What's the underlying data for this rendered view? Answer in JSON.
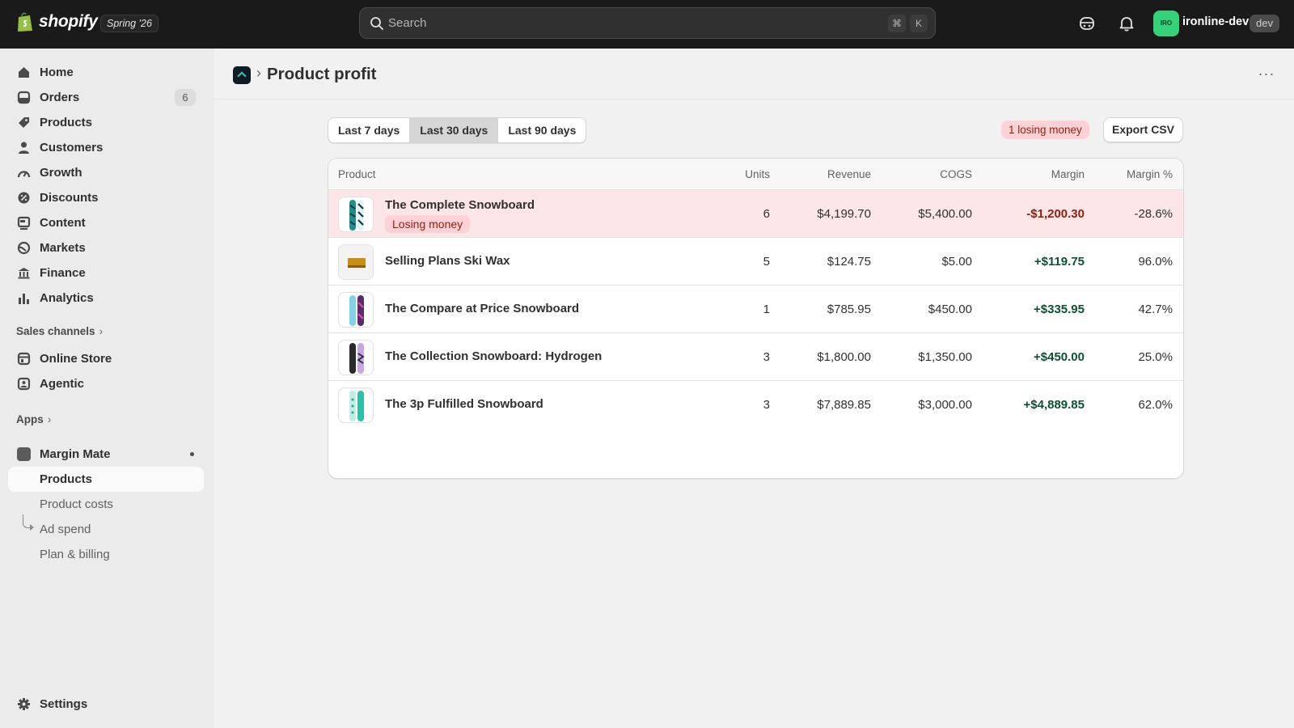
{
  "topbar": {
    "brand": "shopify",
    "edition": "Spring '26",
    "search_placeholder": "Search",
    "shortcut_cmd": "⌘",
    "shortcut_key": "K",
    "avatar_initials": "IRO",
    "store_name": "ironline-dev",
    "store_badge": "dev"
  },
  "sidebar": {
    "items": [
      {
        "label": "Home",
        "icon": "home-icon"
      },
      {
        "label": "Orders",
        "icon": "orders-icon",
        "count": "6"
      },
      {
        "label": "Products",
        "icon": "tag-icon"
      },
      {
        "label": "Customers",
        "icon": "person-icon"
      },
      {
        "label": "Growth",
        "icon": "growth-icon"
      },
      {
        "label": "Discounts",
        "icon": "discount-icon"
      },
      {
        "label": "Content",
        "icon": "content-icon"
      },
      {
        "label": "Markets",
        "icon": "globe-icon"
      },
      {
        "label": "Finance",
        "icon": "bank-icon"
      },
      {
        "label": "Analytics",
        "icon": "chart-icon"
      }
    ],
    "sales_channels_label": "Sales channels",
    "channels": [
      {
        "label": "Online Store",
        "icon": "store-icon"
      },
      {
        "label": "Agentic",
        "icon": "agent-icon"
      }
    ],
    "apps_label": "Apps",
    "app": {
      "name": "Margin Mate",
      "subitems": [
        "Products",
        "Product costs",
        "Ad spend",
        "Plan & billing"
      ]
    },
    "settings_label": "Settings"
  },
  "page": {
    "title": "Product profit",
    "more": "···",
    "ranges": [
      "Last 7 days",
      "Last 30 days",
      "Last 90 days"
    ],
    "selected_range": "Last 30 days",
    "losing_summary": "1 losing money",
    "export_label": "Export CSV"
  },
  "table": {
    "headers": {
      "product": "Product",
      "units": "Units",
      "revenue": "Revenue",
      "cogs": "COGS",
      "margin": "Margin",
      "margin_pct": "Margin %"
    },
    "rows": [
      {
        "name": "The Complete Snowboard",
        "badge": "Losing money",
        "units": "6",
        "revenue": "$4,199.70",
        "cogs": "$5,400.00",
        "margin": "-$1,200.30",
        "margin_pct": "-28.6%"
      },
      {
        "name": "Selling Plans Ski Wax",
        "units": "5",
        "revenue": "$124.75",
        "cogs": "$5.00",
        "margin": "+$119.75",
        "margin_pct": "96.0%"
      },
      {
        "name": "The Compare at Price Snowboard",
        "units": "1",
        "revenue": "$785.95",
        "cogs": "$450.00",
        "margin": "+$335.95",
        "margin_pct": "42.7%"
      },
      {
        "name": "The Collection Snowboard: Hydrogen",
        "units": "3",
        "revenue": "$1,800.00",
        "cogs": "$1,350.00",
        "margin": "+$450.00",
        "margin_pct": "25.0%"
      },
      {
        "name": "The 3p Fulfilled Snowboard",
        "units": "3",
        "revenue": "$7,889.85",
        "cogs": "$3,000.00",
        "margin": "+$4,889.85",
        "margin_pct": "62.0%"
      }
    ]
  },
  "colors": {
    "topbar": "#1a1a1a",
    "loss_text": "#8e1f0b",
    "loss_row_bg": "#fde6e7",
    "gain_text": "#0c5132",
    "avatar": "#36d27a"
  }
}
